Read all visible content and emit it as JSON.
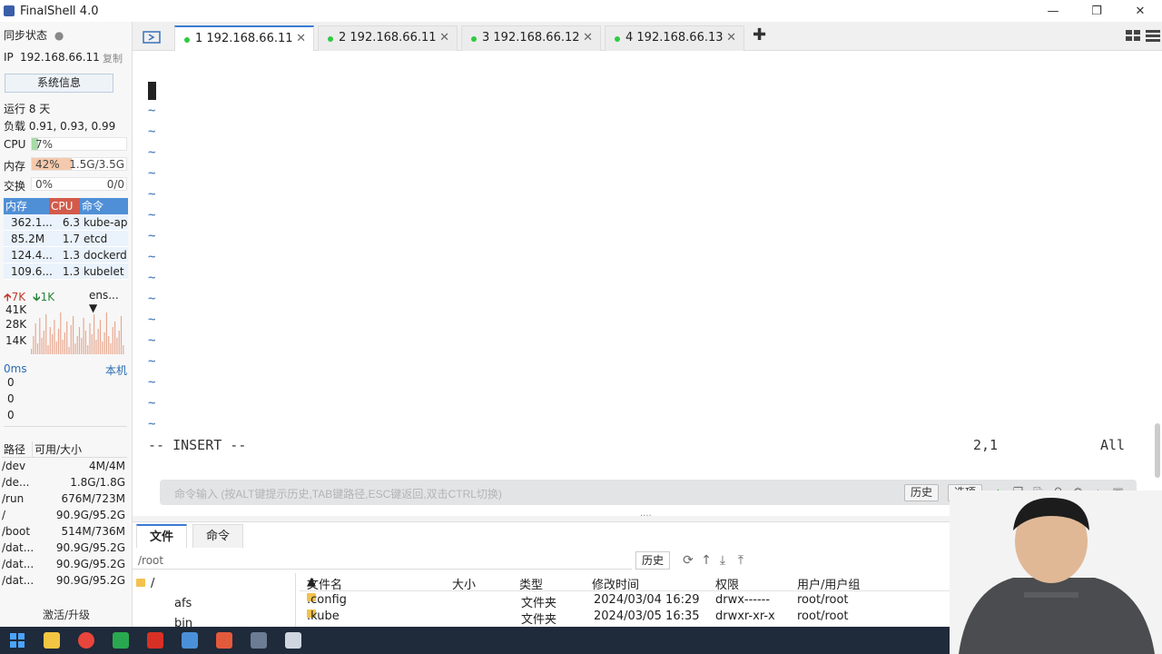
{
  "app": {
    "title": "FinalShell 4.0"
  },
  "sidebar": {
    "sync_status": "同步状态",
    "ip_label": "IP",
    "ip_value": "192.168.66.11",
    "copy_label": "复制",
    "sysinfo_button": "系统信息",
    "uptime": "运行 8 天",
    "load": "负载 0.91, 0.93, 0.99",
    "cpu": {
      "label": "CPU",
      "percent_text": "7%",
      "percent": 7,
      "color": "#a8dba8"
    },
    "memory": {
      "label": "内存",
      "percent_text": "42%",
      "percent": 42,
      "value": "1.5G/3.5G",
      "color": "#f5c9ac"
    },
    "swap": {
      "label": "交换",
      "percent_text": "0%",
      "percent": 0,
      "value": "0/0",
      "color": "#cccccc"
    },
    "process_table": {
      "headers": {
        "mem": "内存",
        "cpu": "CPU",
        "cmd": "命令"
      },
      "rows": [
        {
          "mem": "362.1...",
          "cpu": "6.3",
          "cmd": "kube-ap"
        },
        {
          "mem": "85.2M",
          "cpu": "1.7",
          "cmd": "etcd"
        },
        {
          "mem": "124.4...",
          "cpu": "1.3",
          "cmd": "dockerd"
        },
        {
          "mem": "109.6...",
          "cpu": "1.3",
          "cmd": "kubelet"
        }
      ]
    },
    "network": {
      "up": "7K",
      "down": "1K",
      "interface": "ens...",
      "y_labels": [
        "41K",
        "28K",
        "14K"
      ]
    },
    "latency": {
      "ms": "0ms",
      "host": "本机",
      "values": [
        "0",
        "0",
        "0"
      ]
    },
    "disk_table": {
      "headers": {
        "path": "路径",
        "size": "可用/大小"
      },
      "rows": [
        {
          "path": "/dev",
          "size": "4M/4M"
        },
        {
          "path": "/de...",
          "size": "1.8G/1.8G"
        },
        {
          "path": "/run",
          "size": "676M/723M"
        },
        {
          "path": "/",
          "size": "90.9G/95.2G"
        },
        {
          "path": "/boot",
          "size": "514M/736M"
        },
        {
          "path": "/dat...",
          "size": "90.9G/95.2G"
        },
        {
          "path": "/dat...",
          "size": "90.9G/95.2G"
        },
        {
          "path": "/dat...",
          "size": "90.9G/95.2G"
        }
      ]
    },
    "upgrade": "激活/升级"
  },
  "tabs": [
    {
      "label": "1 192.168.66.11",
      "active": true
    },
    {
      "label": "2 192.168.66.11",
      "active": false
    },
    {
      "label": "3 192.168.66.12",
      "active": false
    },
    {
      "label": "4 192.168.66.13",
      "active": false
    }
  ],
  "terminal": {
    "mode_line": "-- INSERT --",
    "position": "2,1",
    "scope": "All",
    "tilde_lines": [
      "~",
      "~",
      "~",
      "~",
      "~",
      "~",
      "~",
      "~",
      "~",
      "~",
      "~",
      "~",
      "~",
      "~",
      "~",
      "~"
    ],
    "command_placeholder": "命令输入 (按ALT键提示历史,TAB键路径,ESC键返回,双击CTRL切换)",
    "history_button": "历史",
    "options_button": "选项"
  },
  "file_panel": {
    "tabs": [
      "文件",
      "命令"
    ],
    "path": "/root",
    "history_button": "历史",
    "tree": [
      "/",
      "afs",
      "bin"
    ],
    "columns": {
      "name": "文件名",
      "size": "大小",
      "type": "类型",
      "mtime": "修改时间",
      "perm": "权限",
      "owner": "用户/用户组"
    },
    "files": [
      {
        "name": ".config",
        "size": "",
        "type": "文件夹",
        "mtime": "2024/03/04 16:29",
        "perm": "drwx------",
        "owner": "root/root"
      },
      {
        "name": ".kube",
        "size": "",
        "type": "文件夹",
        "mtime": "2024/03/05 16:35",
        "perm": "drwxr-xr-x",
        "owner": "root/root"
      }
    ]
  },
  "colors": {
    "accent": "#3a7bd5",
    "process_header": "#4f8fd6",
    "cpu_header": "#d35a4a",
    "connected_dot": "#2ecc40",
    "taskbar": "#1f2a3a"
  }
}
